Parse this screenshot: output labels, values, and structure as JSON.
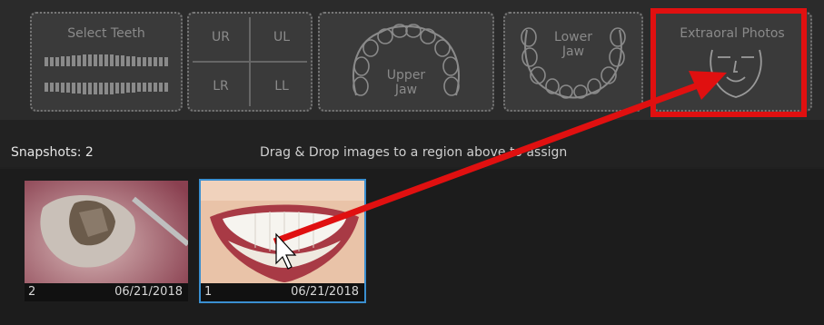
{
  "toolbar": {
    "select_teeth": "Select Teeth",
    "quadrants": {
      "ur": "UR",
      "ul": "UL",
      "lr": "LR",
      "ll": "LL"
    },
    "upper_jaw": "Upper\nJaw",
    "lower_jaw": "Lower\nJaw",
    "extraoral": "Extraoral Photos"
  },
  "status": {
    "snapshots": "Snapshots: 2",
    "hint": "Drag & Drop images to a region above to assign"
  },
  "thumbnails": [
    {
      "number": "2",
      "date": "06/21/2018"
    },
    {
      "number": "1",
      "date": "06/21/2018"
    }
  ],
  "colors": {
    "highlight": "#e01010",
    "selected_border": "#3a8fd0"
  }
}
